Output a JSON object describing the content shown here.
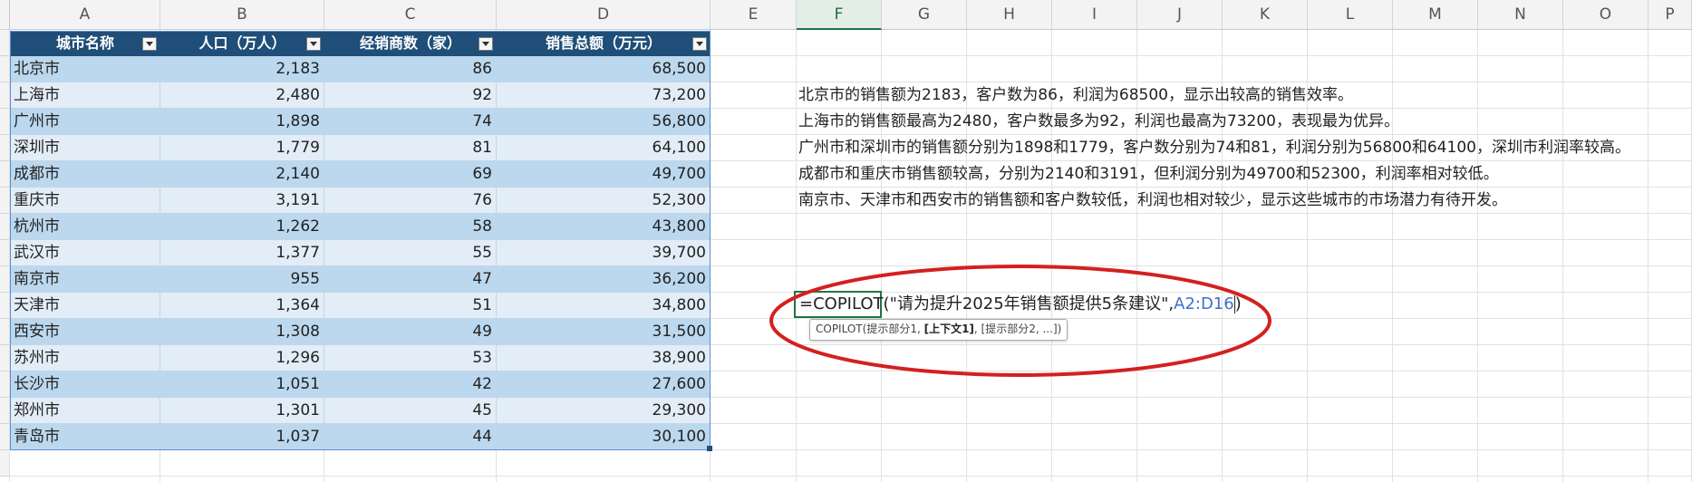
{
  "columns": [
    "A",
    "B",
    "C",
    "D",
    "E",
    "F",
    "G",
    "H",
    "I",
    "J",
    "K",
    "L",
    "M",
    "N",
    "O",
    "P"
  ],
  "selected_column": "F",
  "table": {
    "headers": [
      "城市名称",
      "人口（万人）",
      "经销商数（家）",
      "销售总额（万元）"
    ],
    "rows": [
      [
        "北京市",
        "2,183",
        "86",
        "68,500"
      ],
      [
        "上海市",
        "2,480",
        "92",
        "73,200"
      ],
      [
        "广州市",
        "1,898",
        "74",
        "56,800"
      ],
      [
        "深圳市",
        "1,779",
        "81",
        "64,100"
      ],
      [
        "成都市",
        "2,140",
        "69",
        "49,700"
      ],
      [
        "重庆市",
        "3,191",
        "76",
        "52,300"
      ],
      [
        "杭州市",
        "1,262",
        "58",
        "43,800"
      ],
      [
        "武汉市",
        "1,377",
        "55",
        "39,700"
      ],
      [
        "南京市",
        "955",
        "47",
        "36,200"
      ],
      [
        "天津市",
        "1,364",
        "51",
        "34,800"
      ],
      [
        "西安市",
        "1,308",
        "49",
        "31,500"
      ],
      [
        "苏州市",
        "1,296",
        "53",
        "38,900"
      ],
      [
        "长沙市",
        "1,051",
        "42",
        "27,600"
      ],
      [
        "郑州市",
        "1,301",
        "45",
        "29,300"
      ],
      [
        "青岛市",
        "1,037",
        "44",
        "30,100"
      ]
    ]
  },
  "notes": [
    "北京市的销售额为2183，客户数为86，利润为68500，显示出较高的销售效率。",
    "上海市的销售额最高为2480，客户数最多为92，利润也最高为73200，表现最为优异。",
    "广州市和深圳市的销售额分别为1898和1779，客户数分别为74和81，利润分别为56800和64100，深圳市利润率较高。",
    "成都市和重庆市销售额较高，分别为2140和3191，但利润分别为49700和52300，利润率相对较低。",
    "南京市、天津市和西安市的销售额和客户数较低，利润也相对较少，显示这些城市的市场潜力有待开发。"
  ],
  "formula": {
    "prefix": "=COPILOT(",
    "prompt_string": "\"请为提升2025年销售额提供5条建议\",",
    "range": "A2:D16",
    "suffix": ")"
  },
  "tooltip": {
    "fn": "COPILOT(",
    "p1": "提示部分1, ",
    "ctx": "[上下文1]",
    "rest": ", [提示部分2, ...]",
    "close": ")"
  },
  "colors": {
    "header_bg": "#1f4e79",
    "band_dark": "#bcd8ee",
    "band_light": "#e3edf7",
    "annotation_red": "#d42020",
    "ref_blue": "#3f6fc5"
  }
}
